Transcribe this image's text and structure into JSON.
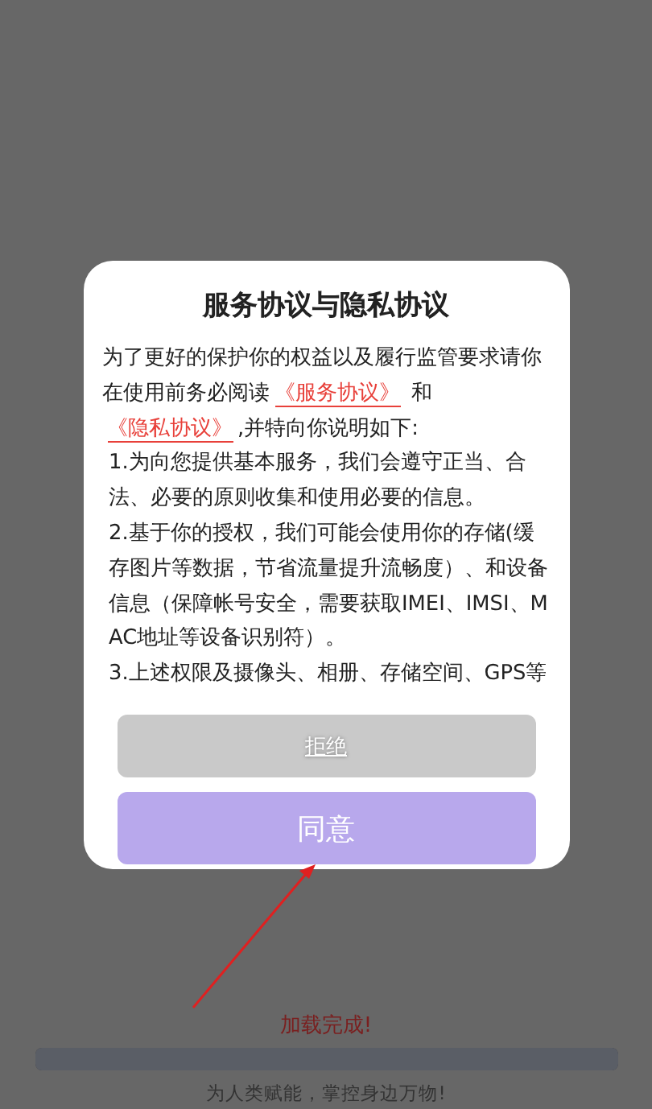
{
  "dialog": {
    "title": "服务协议与隐私协议",
    "intro": [
      {
        "kind": "text",
        "text": "为了更好的保护你的权益以及履行监管要求请你在使用前务必阅读"
      },
      {
        "kind": "link",
        "text": "《服务协议》"
      },
      {
        "kind": "text",
        "text": " 和 "
      },
      {
        "kind": "link",
        "text": "《隐私协议》"
      },
      {
        "kind": "text",
        "text": ",并特向你说明如下:"
      }
    ],
    "points": [
      "1.为向您提供基本服务，我们会遵守正当、合法、必要的原则收集和使用必要的信息。",
      "2.基于你的授权，我们可能会使用你的存储(缓存图片等数据，节省流量提升流畅度）、和设备信息（保障帐号安全，需要获取IMEI、IMSI、MAC地址等设备识别符）。",
      "3.上述权限及摄像头、相册、存储空间、GPS等"
    ],
    "buttons": [
      {
        "kind": "refuse",
        "label": "拒绝"
      },
      {
        "kind": "agree",
        "label": "同意"
      }
    ]
  },
  "loading": {
    "message": "加载完成!",
    "level": 1,
    "slogan": "为人类赋能，掌控身边万物!"
  }
}
